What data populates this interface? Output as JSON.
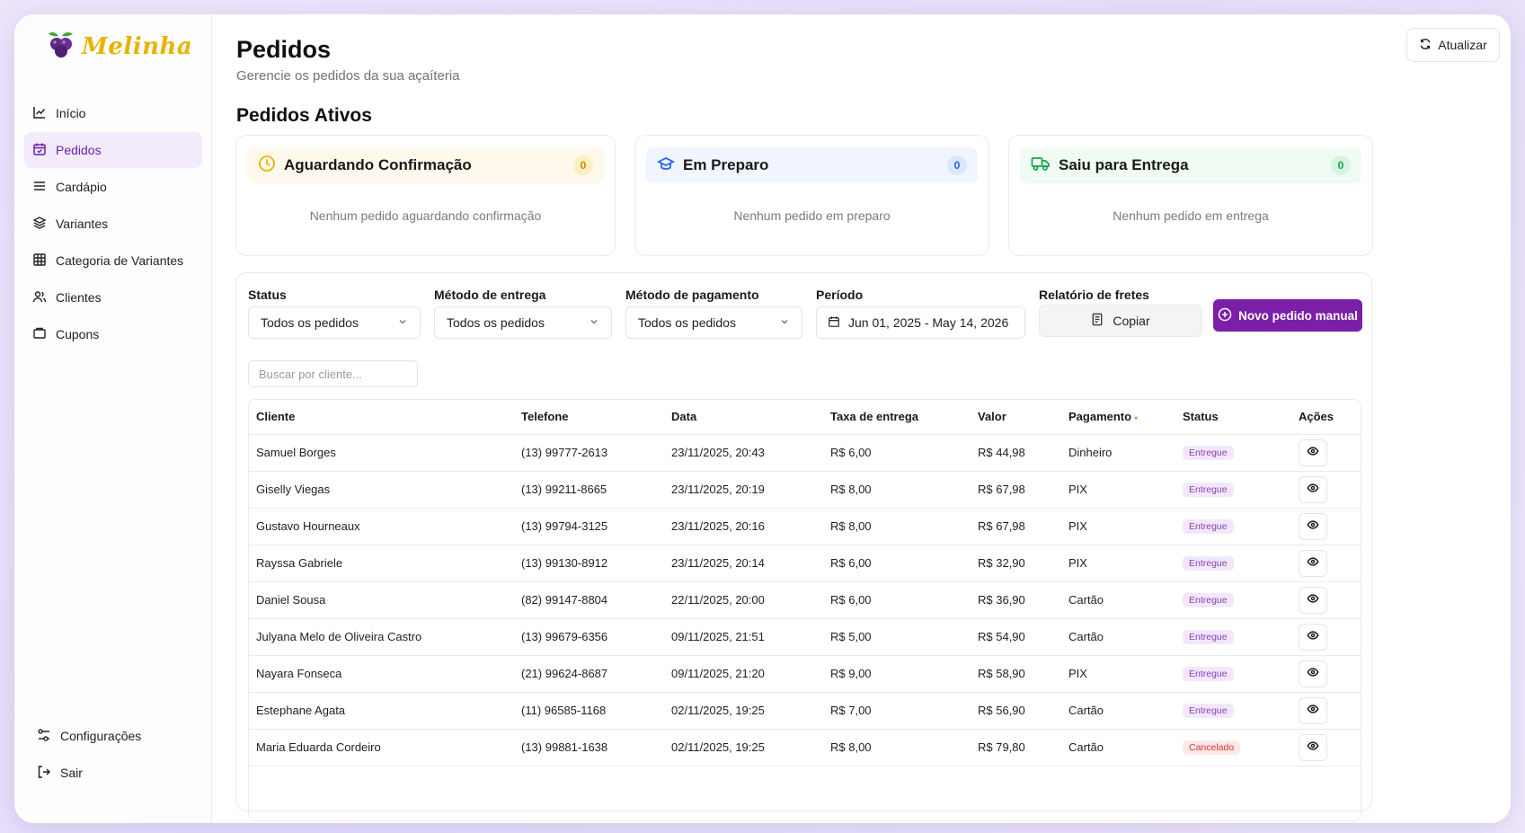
{
  "brand": {
    "name": "Melinha"
  },
  "sidebar": {
    "items": [
      {
        "label": "Início",
        "icon": "chart-line-icon",
        "active": false
      },
      {
        "label": "Pedidos",
        "icon": "calendar-icon",
        "active": true
      },
      {
        "label": "Cardápio",
        "icon": "menu-lines-icon",
        "active": false
      },
      {
        "label": "Variantes",
        "icon": "layers-icon",
        "active": false
      },
      {
        "label": "Categoria de Variantes",
        "icon": "grid-icon",
        "active": false
      },
      {
        "label": "Clientes",
        "icon": "users-icon",
        "active": false
      },
      {
        "label": "Cupons",
        "icon": "ticket-icon",
        "active": false
      }
    ],
    "bottom": [
      {
        "label": "Configurações",
        "icon": "settings-icon"
      },
      {
        "label": "Sair",
        "icon": "logout-icon"
      }
    ]
  },
  "header": {
    "title": "Pedidos",
    "subtitle": "Gerencie os pedidos da sua açaíteria",
    "refresh_label": "Atualizar"
  },
  "active_orders": {
    "title": "Pedidos Ativos",
    "cards": [
      {
        "label": "Aguardando Confirmação",
        "count": "0",
        "empty": "Nenhum pedido aguardando confirmação",
        "icon": "clock-icon",
        "color": "#eab308",
        "bg": "#fef9ec"
      },
      {
        "label": "Em Preparo",
        "count": "0",
        "empty": "Nenhum pedido em preparo",
        "icon": "chef-hat-icon",
        "color": "#2563eb",
        "bg": "#f0f5ff"
      },
      {
        "label": "Saiu para Entrega",
        "count": "0",
        "empty": "Nenhum pedido em entrega",
        "icon": "truck-icon",
        "color": "#16a34a",
        "bg": "#effbf3"
      }
    ]
  },
  "filters": {
    "status": {
      "label": "Status",
      "value": "Todos os pedidos"
    },
    "delivery": {
      "label": "Método de entrega",
      "value": "Todos os pedidos"
    },
    "payment": {
      "label": "Método de pagamento",
      "value": "Todos os pedidos"
    },
    "period": {
      "label": "Período",
      "value": "Jun 01, 2025 - May 14, 2026"
    },
    "report": {
      "label": "Relatório de fretes",
      "copy_label": "Copiar"
    },
    "new_order_label": "Novo pedido manual",
    "search_placeholder": "Buscar por cliente..."
  },
  "table": {
    "columns": [
      "Cliente",
      "Telefone",
      "Data",
      "Taxa de entrega",
      "Valor",
      "Pagamento",
      "Status",
      "Ações"
    ],
    "rows": [
      {
        "cliente": "Samuel Borges",
        "telefone": "(13) 99777-2613",
        "data": "23/11/2025, 20:43",
        "taxa": "R$ 6,00",
        "valor": "R$ 44,98",
        "pagamento": "Dinheiro",
        "status": "Entregue"
      },
      {
        "cliente": "Giselly Viegas",
        "telefone": "(13) 99211-8665",
        "data": "23/11/2025, 20:19",
        "taxa": "R$ 8,00",
        "valor": "R$ 67,98",
        "pagamento": "PIX",
        "status": "Entregue"
      },
      {
        "cliente": "Gustavo Hourneaux",
        "telefone": "(13) 99794-3125",
        "data": "23/11/2025, 20:16",
        "taxa": "R$ 8,00",
        "valor": "R$ 67,98",
        "pagamento": "PIX",
        "status": "Entregue"
      },
      {
        "cliente": "Rayssa Gabriele",
        "telefone": "(13) 99130-8912",
        "data": "23/11/2025, 20:14",
        "taxa": "R$ 6,00",
        "valor": "R$ 32,90",
        "pagamento": "PIX",
        "status": "Entregue"
      },
      {
        "cliente": "Daniel Sousa",
        "telefone": "(82) 99147-8804",
        "data": "22/11/2025, 20:00",
        "taxa": "R$ 6,00",
        "valor": "R$ 36,90",
        "pagamento": "Cartão",
        "status": "Entregue"
      },
      {
        "cliente": "Julyana Melo de Oliveira Castro",
        "telefone": "(13) 99679-6356",
        "data": "09/11/2025, 21:51",
        "taxa": "R$ 5,00",
        "valor": "R$ 54,90",
        "pagamento": "Cartão",
        "status": "Entregue"
      },
      {
        "cliente": "Nayara Fonseca",
        "telefone": "(21) 99624-8687",
        "data": "09/11/2025, 21:20",
        "taxa": "R$ 9,00",
        "valor": "R$ 58,90",
        "pagamento": "PIX",
        "status": "Entregue"
      },
      {
        "cliente": "Estephane Agata",
        "telefone": "(11) 96585-1168",
        "data": "02/11/2025, 19:25",
        "taxa": "R$ 7,00",
        "valor": "R$ 56,90",
        "pagamento": "Cartão",
        "status": "Entregue"
      },
      {
        "cliente": "Maria Eduarda Cordeiro",
        "telefone": "(13) 99881-1638",
        "data": "02/11/2025, 19:25",
        "taxa": "R$ 8,00",
        "valor": "R$ 79,80",
        "pagamento": "Cartão",
        "status": "Cancelado"
      }
    ]
  },
  "colors": {
    "accent": "#7b1fa8",
    "active_nav_bg": "#f3ebfb",
    "entregue_bg": "#f3e8fb",
    "entregue_fg": "#8a3fb5",
    "cancelado_bg": "#fde8e8",
    "cancelado_fg": "#d9332f"
  }
}
